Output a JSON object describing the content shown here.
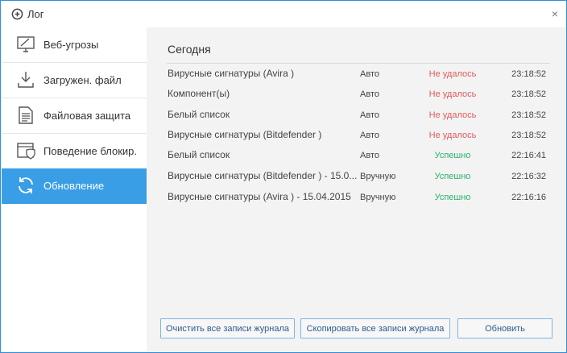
{
  "window": {
    "title": "Лог",
    "close_label": "×"
  },
  "sidebar": {
    "items": [
      {
        "label": "Веб-угрозы",
        "icon": "monitor-icon",
        "active": false
      },
      {
        "label": "Загружен. файл",
        "icon": "download-icon",
        "active": false
      },
      {
        "label": "Файловая защита",
        "icon": "document-icon",
        "active": false
      },
      {
        "label": "Поведение блокир.",
        "icon": "shield-window-icon",
        "active": false
      },
      {
        "label": "Обновление",
        "icon": "refresh-icon",
        "active": true
      }
    ]
  },
  "main": {
    "section_title": "Сегодня",
    "rows": [
      {
        "name": "Вирусные сигнатуры (Avira )",
        "type": "Авто",
        "status": "Не удалось",
        "status_kind": "fail",
        "time": "23:18:52"
      },
      {
        "name": "Компонент(ы)",
        "type": "Авто",
        "status": "Не удалось",
        "status_kind": "fail",
        "time": "23:18:52"
      },
      {
        "name": "Белый список",
        "type": "Авто",
        "status": "Не удалось",
        "status_kind": "fail",
        "time": "23:18:52"
      },
      {
        "name": "Вирусные сигнатуры (Bitdefender )",
        "type": "Авто",
        "status": "Не удалось",
        "status_kind": "fail",
        "time": "23:18:52"
      },
      {
        "name": "Белый список",
        "type": "Авто",
        "status": "Успешно",
        "status_kind": "ok",
        "time": "22:16:41"
      },
      {
        "name": "Вирусные сигнатуры (Bitdefender ) - 15.0...",
        "type": "Вручную",
        "status": "Успешно",
        "status_kind": "ok",
        "time": "22:16:32"
      },
      {
        "name": "Вирусные сигнатуры (Avira ) - 15.04.2015",
        "type": "Вручную",
        "status": "Успешно",
        "status_kind": "ok",
        "time": "22:16:16"
      }
    ]
  },
  "buttons": {
    "clear": "Очистить все записи журнала",
    "copy": "Скопировать все записи журнала",
    "refresh": "Обновить"
  },
  "colors": {
    "accent": "#3a9ee6",
    "fail": "#e45a5a",
    "ok": "#2bb36a"
  }
}
